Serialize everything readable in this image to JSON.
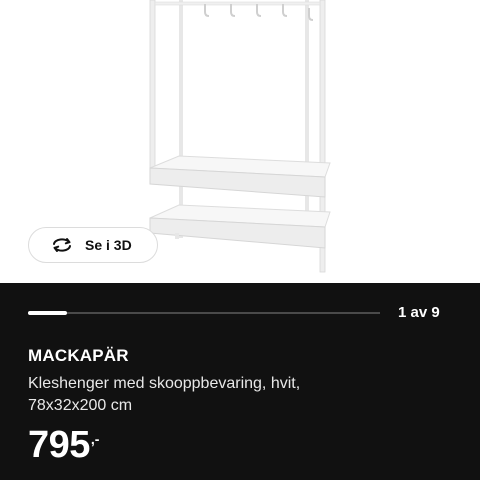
{
  "gallery": {
    "view_3d_label": "Se i 3D",
    "counter_text": "1 av 9",
    "current_index": 1,
    "total_images": 9,
    "progress_fraction": 0.111
  },
  "product": {
    "name": "MACKAPÄR",
    "description_line1": "Kleshenger med skooppbevaring, hvit,",
    "description_line2": "78x32x200 cm",
    "price_amount": "795",
    "price_suffix": ",-"
  },
  "icons": {
    "view_3d": "rotate-3d-icon"
  },
  "colors": {
    "panel_background": "#111111",
    "image_background": "#ffffff",
    "progress_track": "#4a4a4a",
    "progress_fill": "#ffffff"
  }
}
